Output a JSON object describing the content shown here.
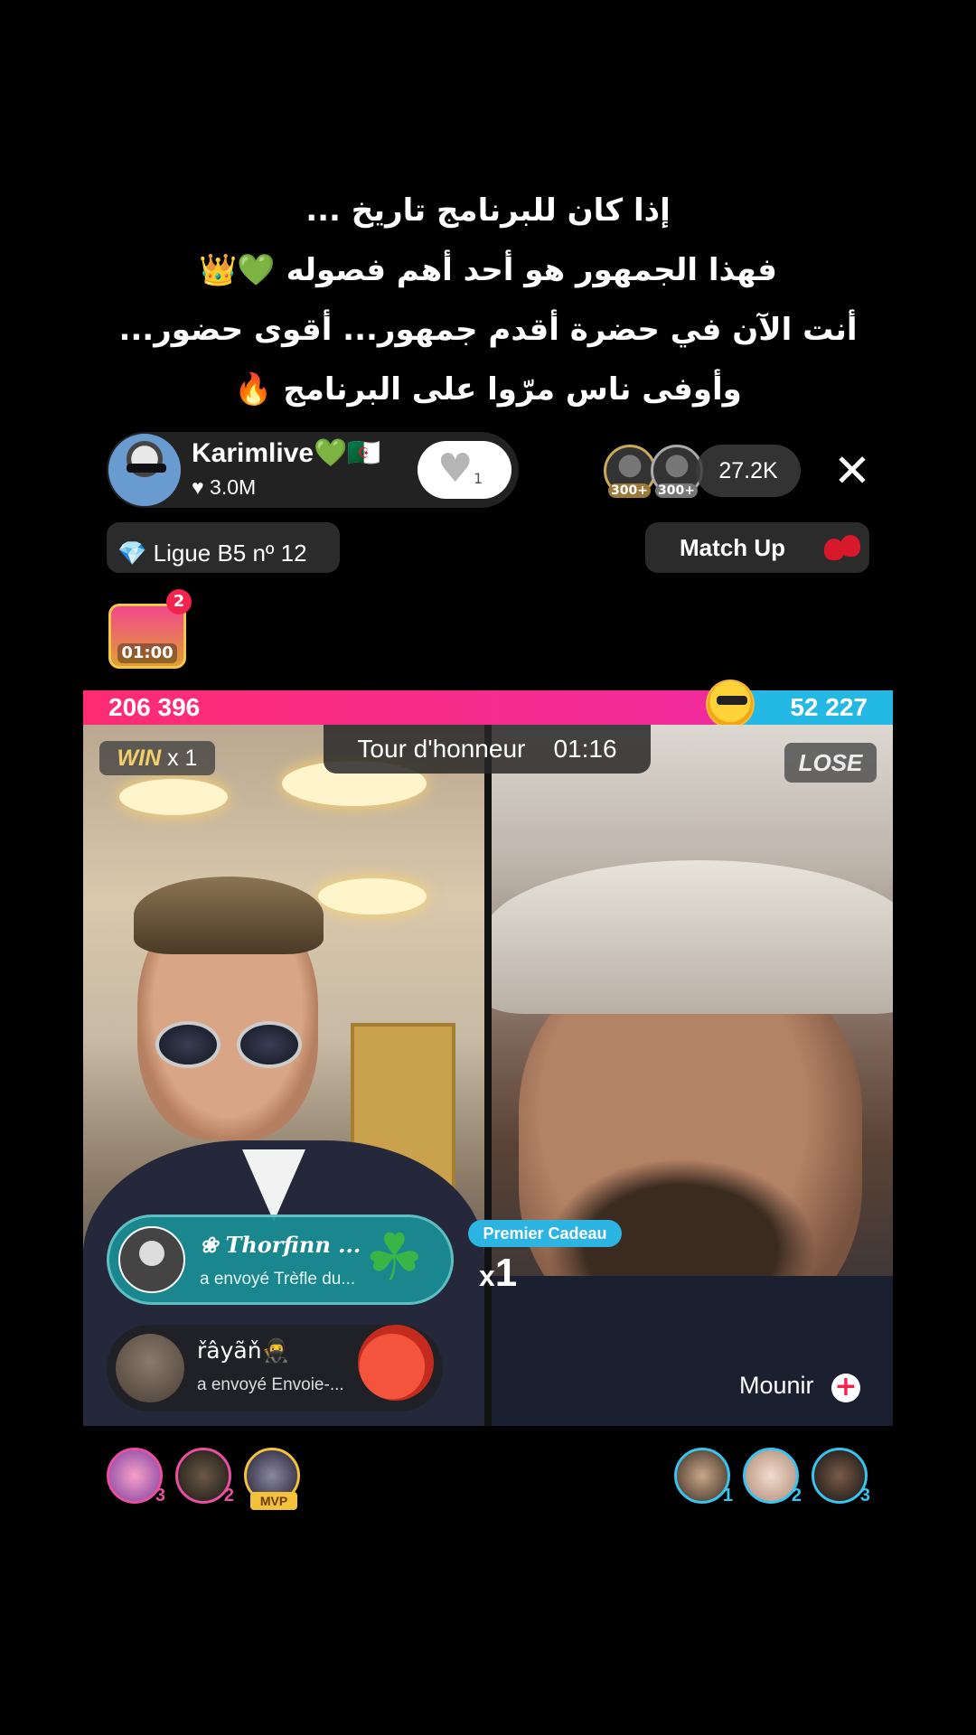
{
  "caption": {
    "lines": [
      "إذا كان للبرنامج تاريخ ...",
      "فهذا الجمهور هو أحد أهم فصوله 💚👑",
      "أنت الآن في حضرة أقدم جمهور... أقوى حضور...",
      "وأوفى ناس مرّوا على البرنامج 🔥"
    ]
  },
  "host": {
    "name": "Karimlive💚🇩🇿",
    "likes": "♥ 3.0M",
    "follow_count": "1"
  },
  "top_viewers": [
    {
      "rank": "300+"
    },
    {
      "rank": "300+"
    }
  ],
  "viewer_count": "27.2K",
  "close_symbol": "✕",
  "league": {
    "label": "Ligue B5 nº 12",
    "icon": "💎"
  },
  "matchup": {
    "label": "Match Up"
  },
  "chest": {
    "timer": "01:00",
    "badge": "2"
  },
  "battle": {
    "left_score": "206 396",
    "right_score": "52 227",
    "left_score_fraction": 0.798,
    "win_label": "WIN",
    "win_mult": "x 1",
    "lose_label": "LOSE",
    "timer_label": "Tour d'honneur",
    "timer_value": "01:16"
  },
  "gifts": [
    {
      "sender": "❀ Thorfinn ...",
      "action": "a envoyé  Trèfle du...",
      "gift_icon": "clover-icon"
    },
    {
      "sender": "řâyãň🥷",
      "action": "a envoyé  Envoie-...",
      "gift_icon": "tomato-icon"
    }
  ],
  "premier": {
    "label": "Premier Cadeau",
    "mult_prefix": "x",
    "mult_value": "1"
  },
  "opponent": {
    "name": "Mounir",
    "follow_symbol": "+"
  },
  "left_supporters": [
    {
      "badge": "3",
      "border": "#e84fa0"
    },
    {
      "badge": "2",
      "border": "#e84fa0"
    },
    {
      "badge": "MVP",
      "border": "#f3c13a"
    }
  ],
  "right_supporters": [
    {
      "badge": "1",
      "border": "#38c4ef"
    },
    {
      "badge": "2",
      "border": "#38c4ef"
    },
    {
      "badge": "3",
      "border": "#38c4ef"
    }
  ],
  "colors": {
    "red_team": "#ff2c73",
    "blue_team": "#24b8e4",
    "gift_teal": "#1a8e96"
  }
}
